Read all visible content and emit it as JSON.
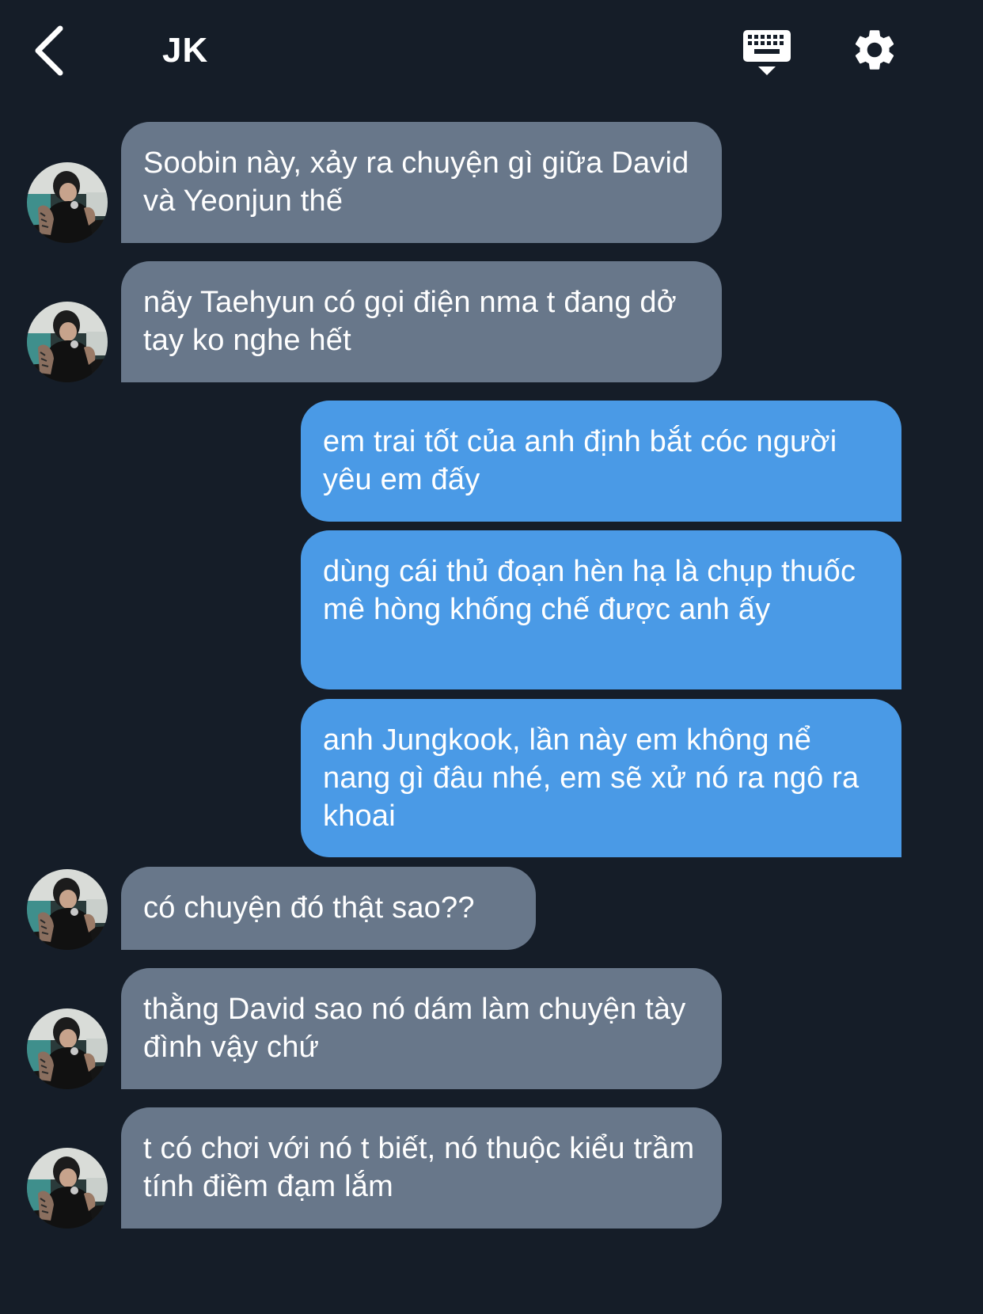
{
  "header": {
    "title": "JK",
    "back_icon": "chevron-left-icon",
    "keyboard_icon": "keyboard-icon",
    "settings_icon": "gear-icon"
  },
  "colors": {
    "background": "#151d28",
    "incoming_bubble": "#68778a",
    "outgoing_bubble": "#4a9ae6",
    "text": "#ffffff"
  },
  "messages": [
    {
      "sender": "JK",
      "direction": "incoming",
      "text": "Soobin này, xảy ra chuyện gì giữa David và Yeonjun thế"
    },
    {
      "sender": "JK",
      "direction": "incoming",
      "text": "nãy Taehyun có gọi điện nma t đang dở tay ko nghe hết"
    },
    {
      "sender": "me",
      "direction": "outgoing",
      "text": "em trai tốt của anh định bắt cóc người yêu em đấy"
    },
    {
      "sender": "me",
      "direction": "outgoing",
      "text": "dùng cái thủ đoạn hèn hạ là chụp thuốc mê hòng khống chế được anh ấy"
    },
    {
      "sender": "me",
      "direction": "outgoing",
      "text": "anh Jungkook, lần này em không nể nang gì đâu nhé, em sẽ xử nó ra ngô ra khoai"
    },
    {
      "sender": "JK",
      "direction": "incoming",
      "text": "có chuyện đó thật sao??"
    },
    {
      "sender": "JK",
      "direction": "incoming",
      "text": "thằng David sao nó dám làm chuyện tày đình vậy chứ"
    },
    {
      "sender": "JK",
      "direction": "incoming",
      "text": "t có chơi với nó t biết, nó thuộc kiểu trầm tính điềm đạm lắm"
    }
  ]
}
